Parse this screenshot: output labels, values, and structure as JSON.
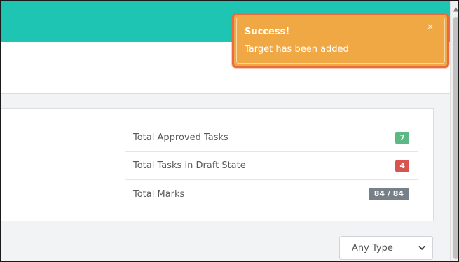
{
  "toast": {
    "title": "Success!",
    "message": "Target has been added",
    "close_glyph": "×"
  },
  "stats": {
    "items": [
      {
        "label": "Total Approved Tasks",
        "value": "7",
        "badge_color": "#5cb884"
      },
      {
        "label": "Total Tasks in Draft State",
        "value": "4",
        "badge_color": "#d9534f"
      },
      {
        "label": "Total Marks",
        "value": "84 / 84",
        "badge_color": "#777f88"
      }
    ]
  },
  "filter": {
    "type_select_value": "Any Type"
  },
  "colors": {
    "header": "#1fc5b3",
    "toast_background": "#f0a844",
    "toast_border": "#ec6b3c"
  },
  "icons": {
    "dropdown": "chevron-down-icon",
    "close": "close-icon",
    "scroll_up": "arrow-up-icon"
  }
}
